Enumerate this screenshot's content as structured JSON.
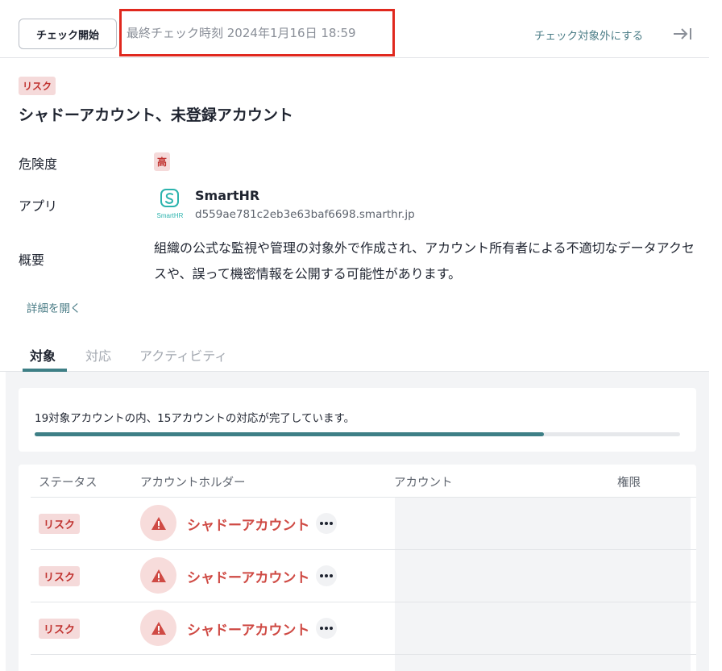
{
  "toolbar": {
    "check_button": "チェック開始",
    "last_check": "最終チェック時刻 2024年1月16日 18:59",
    "exclude_link": "チェック対象外にする",
    "collapse_icon": "collapse-panel-icon"
  },
  "header": {
    "tag": "リスク",
    "title": "シャドーアカウント、未登録アカウント"
  },
  "properties": {
    "severity_label": "危険度",
    "severity_value": "高",
    "app_label": "アプリ",
    "app_name": "SmartHR",
    "app_domain": "d559ae781c2eb3e63baf6698.smarthr.jp",
    "app_logo_text": "SmartHR",
    "summary_label": "概要",
    "summary_text": "組織の公式な監視や管理の対象外で作成され、アカウント所有者による不適切なデータアクセスや、誤って機密情報を公開する可能性があります。"
  },
  "detail_link": "詳細を開く",
  "tabs": [
    {
      "label": "対象",
      "active": true
    },
    {
      "label": "対応",
      "active": false
    },
    {
      "label": "アクティビティ",
      "active": false
    }
  ],
  "progress": {
    "text": "19対象アカウントの内、15アカウントの対応が完了しています。",
    "completed": 15,
    "total": 19
  },
  "table": {
    "headers": [
      "ステータス",
      "アカウントホルダー",
      "アカウント",
      "権限"
    ],
    "rows": [
      {
        "status": "リスク",
        "holder": "シャドーアカウント"
      },
      {
        "status": "リスク",
        "holder": "シャドーアカウント"
      },
      {
        "status": "リスク",
        "holder": "シャドーアカウント"
      }
    ]
  },
  "colors": {
    "accent": "#3e7f86",
    "risk": "#c0322f",
    "highlight_border": "#e0281e"
  }
}
